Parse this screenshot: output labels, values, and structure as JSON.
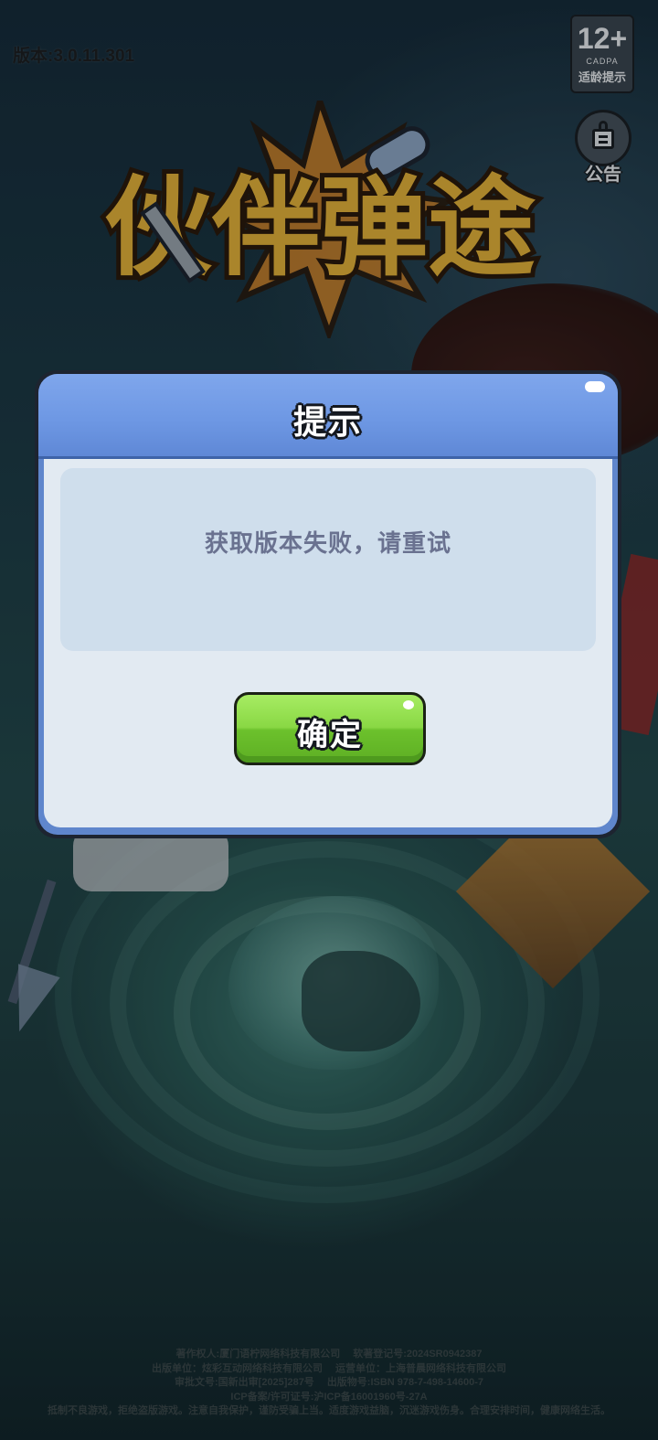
{
  "version": "版本:3.0.11.301",
  "age_rating": {
    "number": "12+",
    "org": "CADPA",
    "label": "适龄提示"
  },
  "announcement": {
    "label": "公告"
  },
  "logo": {
    "title": "伙伴弹途"
  },
  "dialog": {
    "title": "提示",
    "message": "获取版本失败，请重试",
    "confirm_label": "确定"
  },
  "footer": {
    "copyright_holder": "著作权人:厦门语柠网络科技有限公司",
    "software_reg": "软著登记号:2024SR0942387",
    "publisher": "出版单位：炫彩互动网络科技有限公司",
    "operator": "运营单位：上海普晨网络科技有限公司",
    "approval": "审批文号:国新出审[2025]287号",
    "isbn": "出版物号:ISBN 978-7-498-14600-7",
    "icp": "ICP备案/许可证号:沪ICP备16001960号-27A",
    "health_notice": "抵制不良游戏，拒绝盗版游戏。注意自我保护，谨防受骗上当。适度游戏益脑，沉迷游戏伤身。合理安排时间，健康网络生活。"
  },
  "colors": {
    "dialog_header": "#6e98e4",
    "dialog_body": "#e2eaf2",
    "message_box": "#cfdeec",
    "message_text": "#6a7290",
    "confirm_button": "#89d844",
    "logo_fill": "#e3b23a"
  }
}
